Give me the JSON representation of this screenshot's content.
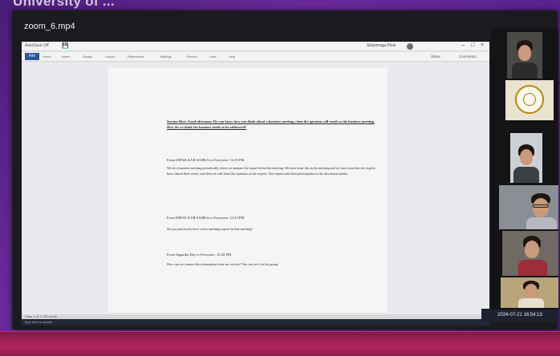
{
  "stage": {
    "caption": "University of ..."
  },
  "window": {
    "title": "zoom_6.mp4"
  },
  "word": {
    "autosave_label": "AutoSave Off",
    "user_name": "Shanmuga Pixel",
    "ribbon_tabs": [
      "File",
      "Home",
      "Insert",
      "Design",
      "Layout",
      "References",
      "Mailings",
      "Review",
      "View",
      "Help"
    ],
    "share_label": "Share",
    "comments_label": "Comments",
    "status_text": "Page 1 of 1   126 words"
  },
  "document": {
    "question": "Session Host: Good afternoon. Do you know how you think about a business meeting when the question will result as the business meeting. How do we think the business needs to be addressed?",
    "messages": [
      {
        "header": "From  DIPAK KAR SAHKA  to  Everyone:   12:23 PM",
        "body": "We do a business meeting periodically where we prepare the report before the meeting. We have done this in the meeting and we have seen that the experts have shared their views, and then we will share the opinions of the experts. The experts and their participation in the discussion matter."
      },
      {
        "header": "From  DIPAK KAR SAHKA  to  Everyone:   12:24 PM",
        "body": "Do you previously have such a meeting report for that meeting?"
      },
      {
        "header": "From  Sagarika Dey  to  Everyone:   12:25 PM",
        "body": "How can we connect the information from our society?  You can see it in the group."
      }
    ]
  },
  "taskbar": {
    "left_text": "Type here to search",
    "clock": "2024-07-21  16:54:13"
  },
  "participants": {
    "count": 7
  },
  "colors": {
    "word_accent": "#2b579a",
    "backdrop": "#5a2390"
  }
}
